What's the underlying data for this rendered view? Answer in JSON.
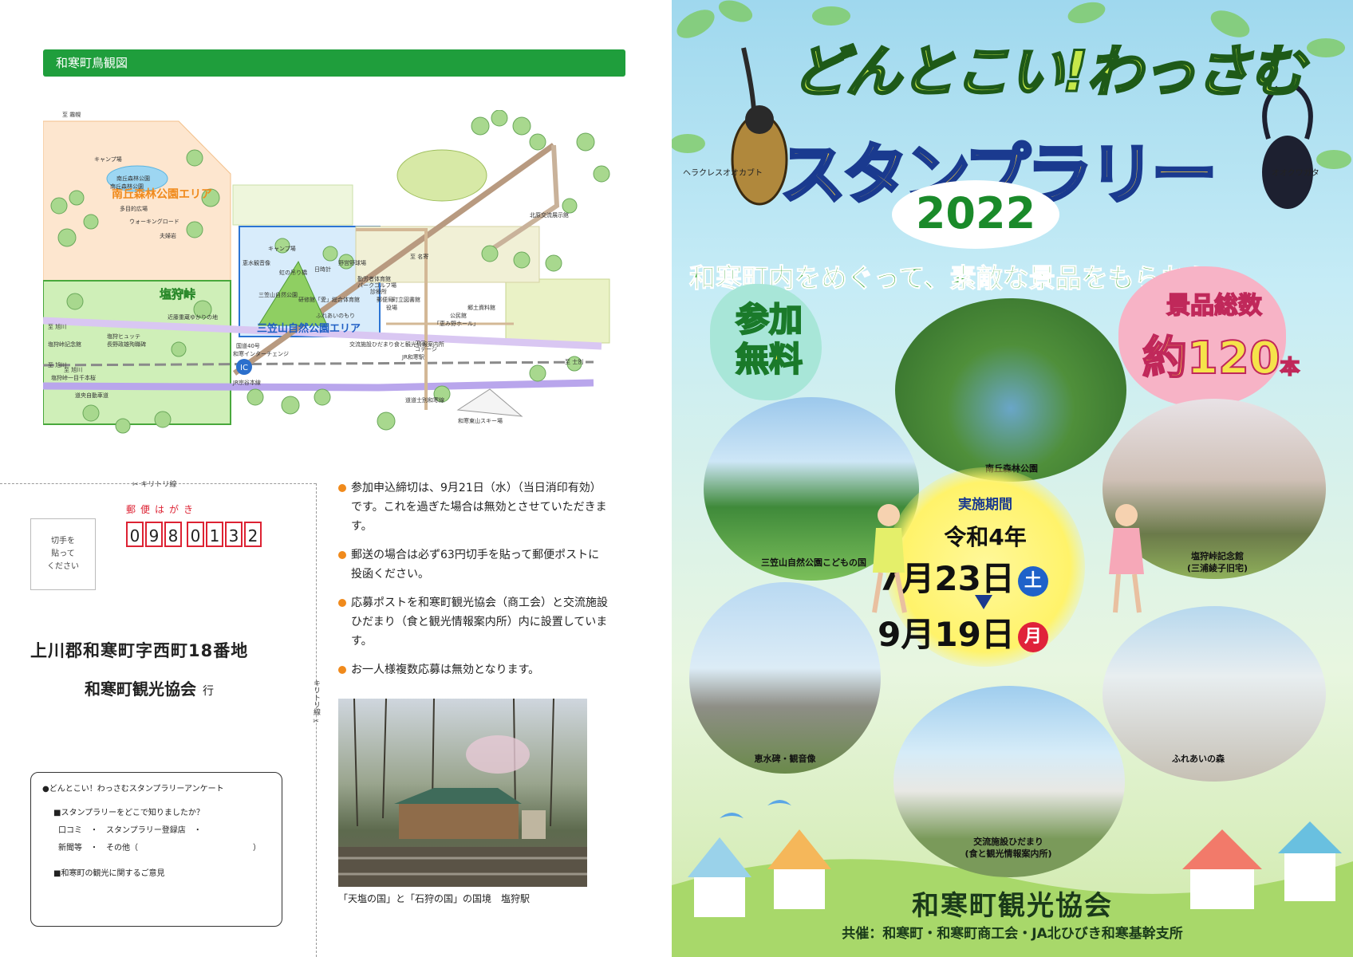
{
  "map": {
    "header": "和寒町鳥観図",
    "areas": {
      "minamioka": "南丘森林公園エリア",
      "shiokari": "塩狩峠",
      "mikasayama": "三笠山自然公園エリア"
    },
    "labels": {
      "l01": "キャンプ場",
      "l02": "南丘森林公園",
      "l03": "多目的広場",
      "l04": "ウォーキングロード",
      "l05": "夫婦岩",
      "l06": "近藤重蔵ゆかりの地",
      "l07": "塩狩峠記念館",
      "l08": "塩狩ヒュッテ",
      "l09": "長野政雄殉職碑",
      "l10": "塩狩峠一目千本桜",
      "l11": "道央自動車道",
      "l12": "キャンプ場",
      "l13": "恵水観音像",
      "l14": "虹の吊り橋",
      "l15": "日時計",
      "l16": "野営野球場",
      "l17": "パークゴルフ場",
      "l18": "三笠山自然公園",
      "l19": "研修館「愛」総合体育館",
      "l20": "ふれあいのもり",
      "l21": "交流施設ひだまり食と観光情報案内所",
      "l22": "エコ",
      "l23": "コテージ",
      "l24": "和寒インターチェンジ",
      "l25": "国道40号",
      "l26": "JR宗谷本線",
      "l27": "JR和寒駅",
      "l28": "郷土資料館",
      "l29": "公民館",
      "l30": "「恵み野ホール」",
      "l31": "北原交流展示館",
      "l32": "和寒東山スキー場",
      "l33": "道道士別和寒線",
      "l34": "至 旭川",
      "l35": "至 旭川",
      "l36": "至 旭川",
      "l37": "至 士別",
      "l38": "至 霧幌",
      "l39": "IC",
      "l40": "役場",
      "l41": "町立図書館",
      "l42": "勤労者体育館",
      "l43": "診療所",
      "l44": "郵便局",
      "l45": "至 名寄",
      "l46": "南丘森林公園"
    }
  },
  "postcard": {
    "cut_label_h": "キリトリ線",
    "cut_label_v": "キリトリ線",
    "title": "郵便はがき",
    "zip": [
      "0",
      "9",
      "8",
      "0",
      "1",
      "3",
      "2"
    ],
    "stamp": [
      "切手を",
      "貼って",
      "ください"
    ],
    "address": "上川郡和寒町字西町18番地",
    "recipient": "和寒町観光協会",
    "recipient_suffix": "行",
    "survey": {
      "title": "●どんとこい！わっさむスタンプラリーアンケート",
      "q1": "■スタンプラリーをどこで知りましたか？",
      "opt1": "口コミ　・　スタンプラリー登録店　・",
      "opt2": "新聞等　・　その他（",
      "opt2_close": "）",
      "q2": "■和寒町の観光に関するご意見"
    }
  },
  "notes": [
    "参加申込締切は、9月21日（水）（当日消印有効）です。これを過ぎた場合は無効とさせていただきます。",
    "郵送の場合は必ず63円切手を貼って郵便ポストに投函ください。",
    "応募ポストを和寒町観光協会（商工会）と交流施設ひだまり（食と観光情報案内所）内に設置しています。",
    "お一人様複数応募は無効となります。"
  ],
  "photo_caption": "「天塩の国」と「石狩の国」の国境　塩狩駅",
  "cover": {
    "title1": "どんとこい!わっさむ",
    "title2": "スタンプラリー",
    "year": "2022",
    "beetle_left": "ヘラクレスオオカブト",
    "beetle_right": "オオクワガタ",
    "tagline": "和寒町内をめぐって、素敵な景品をもらおう!",
    "free_badge": [
      "参加",
      "無料"
    ],
    "prize_t1": "景品総数",
    "prize_t2": "約120",
    "prize_unit": "本",
    "spots": {
      "minamioka": "南丘森林公園",
      "kodomo": "三笠山自然公園こどもの国",
      "shiokari": "塩狩峠記念館\n(三浦綾子旧宅)",
      "keisui": "恵水碑・観音像",
      "fureai": "ふれあいの森",
      "hidamari": "交流施設ひだまり\n(食と観光情報案内所)"
    },
    "period": {
      "label": "実施期間",
      "era": "令和4年",
      "start": "7月23日",
      "start_day": "土",
      "end": "9月19日",
      "end_day": "月"
    },
    "organizer": "和寒町観光協会",
    "sponsors": "共催：和寒町・和寒町商工会・JA北ひびき和寒基幹支所",
    "colors": {
      "sat": "#1f62c9",
      "mon": "#e0223a",
      "green": "#1f9e3c"
    }
  }
}
